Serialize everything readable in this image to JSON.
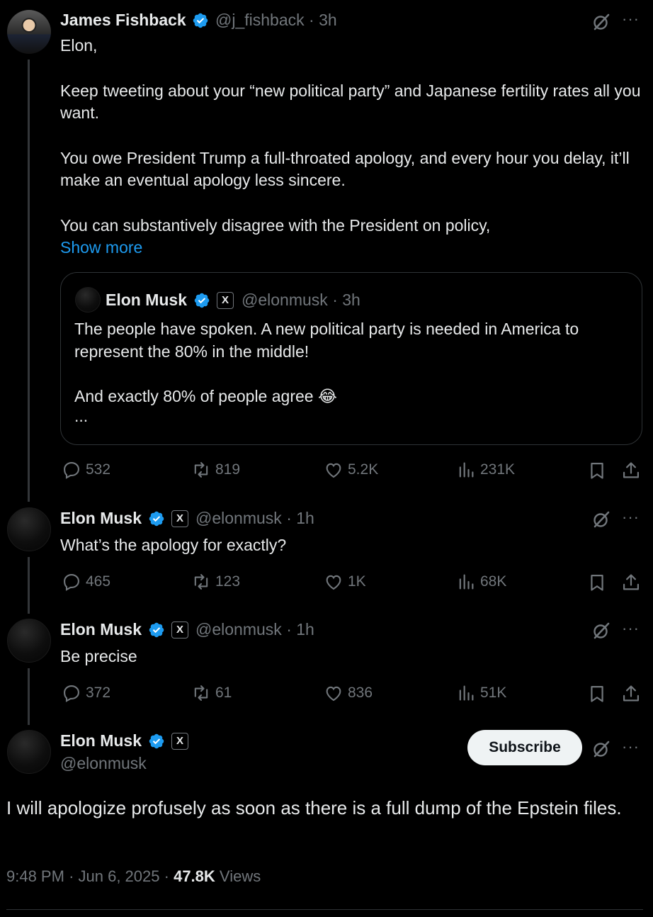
{
  "tweet1": {
    "name": "James Fishback",
    "handle": "@j_fishback",
    "time": "3h",
    "lines": [
      "Elon,",
      "Keep tweeting about your “new political party” and Japanese fertility rates all you want.",
      "You owe President Trump a full-throated apology, and every hour you delay, it’ll make an eventual apology less sincere.",
      "You can substantively disagree with the President on policy,"
    ],
    "show_more": "Show more",
    "quote": {
      "name": "Elon Musk",
      "x_badge": "X",
      "handle": "@elonmusk",
      "time": "3h",
      "line1": "The people have spoken. A new political party is needed in America to represent the 80% in the middle!",
      "line2": "And exactly 80% of people agree 😂",
      "ellipsis": "..."
    },
    "stats": {
      "replies": "532",
      "reposts": "819",
      "likes": "5.2K",
      "views": "231K"
    }
  },
  "tweet2": {
    "name": "Elon Musk",
    "x_badge": "X",
    "handle": "@elonmusk",
    "time": "1h",
    "text": "What’s the apology for exactly?",
    "stats": {
      "replies": "465",
      "reposts": "123",
      "likes": "1K",
      "views": "68K"
    }
  },
  "tweet3": {
    "name": "Elon Musk",
    "x_badge": "X",
    "handle": "@elonmusk",
    "time": "1h",
    "text": "Be precise",
    "stats": {
      "replies": "372",
      "reposts": "61",
      "likes": "836",
      "views": "51K"
    }
  },
  "main": {
    "name": "Elon Musk",
    "x_badge": "X",
    "handle": "@elonmusk",
    "subscribe_label": "Subscribe",
    "text": "I will apologize profusely as soon as there is a full dump of the Epstein files.",
    "time": "9:48 PM",
    "date": "Jun 6, 2025",
    "views_count": "47.8K",
    "views_label": "Views"
  },
  "meta_sep": "·",
  "more_glyph": "···",
  "colors": {
    "background": "#000000",
    "text": "#e7e9ea",
    "muted": "#71767b",
    "link": "#1d9bf0",
    "verified": "#1d9bf0",
    "border": "#2f3336"
  }
}
